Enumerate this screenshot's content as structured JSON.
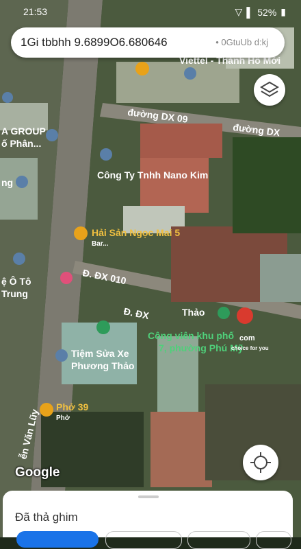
{
  "status": {
    "time": "21:53",
    "battery": "52%"
  },
  "search": {
    "query": "1Gi tbbhh 9.6899O6.680646",
    "right_text": "• 0GtuUb d:kj"
  },
  "map": {
    "labels": {
      "viettel": "Viettel - Thành Hồ Mới",
      "dx09_a": "đường DX 09",
      "dx09_b": "đường DX",
      "agroup1": "A GROUP",
      "agroup2": "ố Phân...",
      "nano": "Công Ty Tnhh Nano Kim",
      "ng": "ng",
      "haisan": "Hải Sản Ngọc Mai 5",
      "bar": "Bar...",
      "oto1": "ệ Ô Tô",
      "oto2": "Trung",
      "dx010": "Đ. ĐX 010",
      "dx_small": "Đ. ĐX",
      "thao": "Thảo",
      "congvien1": "Công viên khu phố",
      "congvien2": "7, phường Phú Mỹ",
      "tiem1": "Tiệm Sửa Xe",
      "tiem2": "Phương Thảo",
      "pho39": "Phở 39",
      "pho": "Phở",
      "vanluy": "ễn Văn Lũy",
      "watermark": "com",
      "watermark2": "choice for you"
    },
    "google": "Google"
  },
  "sheet": {
    "title": "Đã thả ghim"
  },
  "colors": {
    "pin_blue": "#5a7fa8",
    "pin_orange": "#e8a21a",
    "pin_green": "#2e9b5a",
    "pin_pink": "#e0507a"
  }
}
